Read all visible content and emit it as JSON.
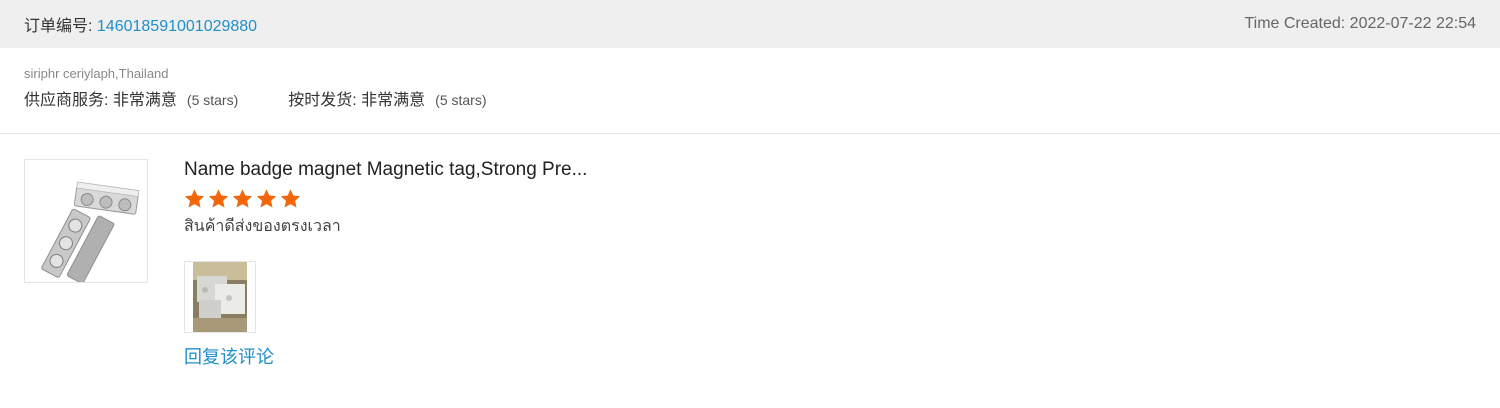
{
  "order": {
    "label": "订单编号:",
    "number": "146018591001029880",
    "time_created": "Time Created: 2022-07-22 22:54"
  },
  "buyer": {
    "name": "siriphr ceriylaph,Thailand"
  },
  "ratings": [
    {
      "label": "供应商服务: 非常满意",
      "stars_text": "(5 stars)"
    },
    {
      "label": "按时发货: 非常满意",
      "stars_text": "(5 stars)"
    }
  ],
  "product": {
    "title": "Name badge magnet Magnetic tag,Strong Pre...",
    "rating": 5,
    "star_color": "#f4660a",
    "comment": "สินค้าดีส่งของตรงเวลา",
    "reply_label": "回复该评论"
  },
  "colors": {
    "link": "#1e8ec9",
    "header_bg": "#efefef"
  }
}
